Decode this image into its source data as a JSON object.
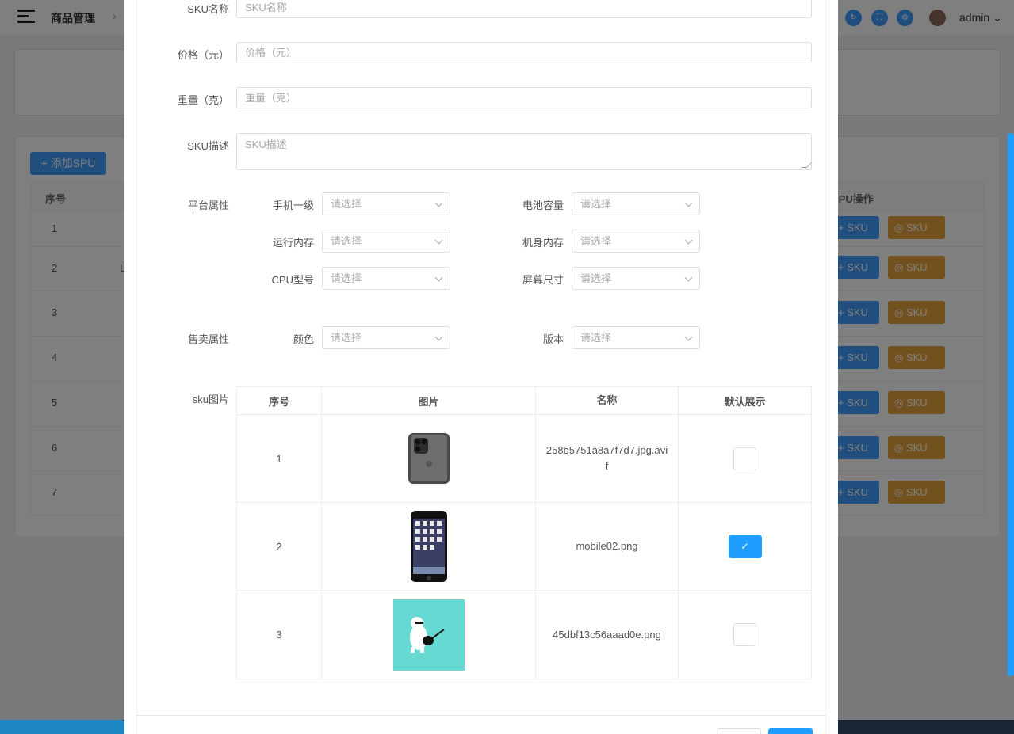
{
  "header": {
    "breadcrumb": "商品管理",
    "user": "admin",
    "tools": [
      "refresh-icon",
      "fullscreen-icon",
      "settings-icon"
    ]
  },
  "background": {
    "add_spu_label": "+ 添加SPU",
    "table_headers": [
      "序号",
      "SPU操作"
    ],
    "rows": [
      {
        "num": "1",
        "extra": ""
      },
      {
        "num": "2",
        "extra": "L"
      },
      {
        "num": "3",
        "extra": ""
      },
      {
        "num": "4",
        "extra": ""
      },
      {
        "num": "5",
        "extra": ""
      },
      {
        "num": "6",
        "extra": ""
      },
      {
        "num": "7",
        "extra": ""
      }
    ],
    "add_sku_label": "+ SKU",
    "view_sku_label": "◎ SKU"
  },
  "form": {
    "sku_name": {
      "label": "SKU名称",
      "placeholder": "SKU名称"
    },
    "price": {
      "label": "价格（元）",
      "placeholder": "价格（元）"
    },
    "weight": {
      "label": "重量（克）",
      "placeholder": "重量（克）"
    },
    "desc": {
      "label": "SKU描述",
      "placeholder": "SKU描述"
    },
    "platform_label": "平台属性",
    "platform_attrs": [
      {
        "label": "手机一级",
        "value": "请选择"
      },
      {
        "label": "电池容量",
        "value": "请选择"
      },
      {
        "label": "运行内存",
        "value": "请选择"
      },
      {
        "label": "机身内存",
        "value": "请选择"
      },
      {
        "label": "CPU型号",
        "value": "请选择"
      },
      {
        "label": "屏幕尺寸",
        "value": "请选择"
      }
    ],
    "sale_label": "售卖属性",
    "sale_attrs": [
      {
        "label": "颜色",
        "value": "请选择"
      },
      {
        "label": "版本",
        "value": "请选择"
      }
    ],
    "image_label": "sku图片",
    "image_table": {
      "headers": [
        "序号",
        "图片",
        "名称",
        "默认展示"
      ],
      "rows": [
        {
          "index": "1",
          "name": "258b5751a8a7f7d7.jpg.avif",
          "default": false
        },
        {
          "index": "2",
          "name": "mobile02.png",
          "default": true
        },
        {
          "index": "3",
          "name": "45dbf13c56aaad0e.png",
          "default": false
        }
      ]
    },
    "check_mark": "✓"
  }
}
